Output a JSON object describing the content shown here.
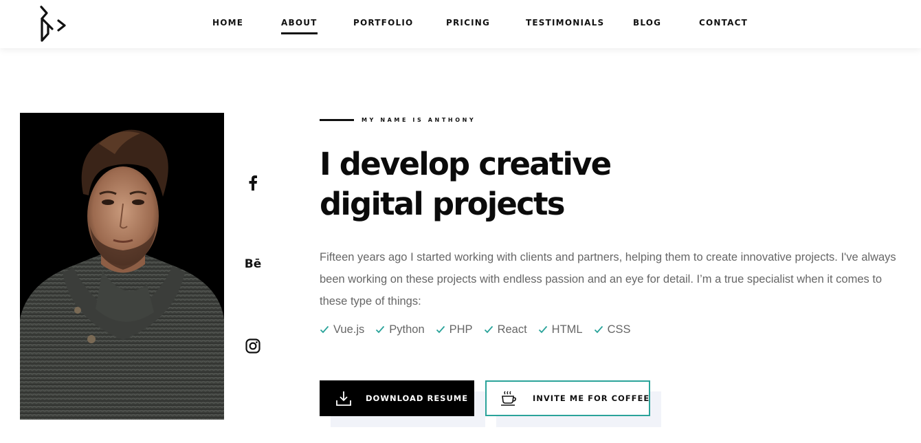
{
  "brand": {
    "logo_icon": "brand-monogram-logo"
  },
  "nav": {
    "items": [
      {
        "label": "HOME",
        "active": false
      },
      {
        "label": "ABOUT",
        "active": true
      },
      {
        "label": "PORTFOLIO",
        "active": false
      },
      {
        "label": "PRICING",
        "active": false
      },
      {
        "label": "TESTIMONIALS",
        "active": false
      },
      {
        "label": "BLOG",
        "active": false
      },
      {
        "label": "CONTACT",
        "active": false
      }
    ]
  },
  "social": {
    "facebook_icon": "facebook-icon",
    "behance_label": "Bē",
    "instagram_icon": "instagram-icon"
  },
  "hero": {
    "eyebrow": "MY NAME IS ANTHONY",
    "headline_line1": "I develop creative",
    "headline_line2": "digital projects",
    "paragraph": "Fifteen years ago I started working with clients and partners, helping them to create innovative projects. I've always been working on these projects with endless passion and an eye for detail. I’m a true specialist when it comes to these type of things:",
    "skills": [
      "Vue.js",
      "Python",
      "PHP",
      "React",
      "HTML",
      "CSS"
    ]
  },
  "buttons": {
    "download_label": "DOWNLOAD RESUME",
    "coffee_label": "INVITE ME FOR COFFEE"
  },
  "colors": {
    "accent": "#2aa39a",
    "text_dark": "#111111",
    "text_muted": "#666666",
    "button_dark": "#000000"
  }
}
